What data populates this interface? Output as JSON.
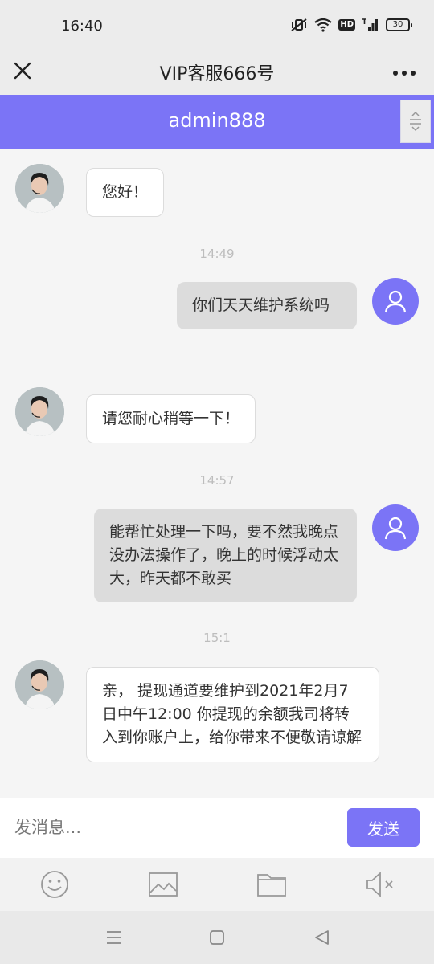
{
  "status_bar": {
    "time": "16:40",
    "battery": "30"
  },
  "title_bar": {
    "title": "VIP客服666号"
  },
  "chat_header": {
    "title": "admin888"
  },
  "messages": [
    {
      "sender": "agent",
      "text": "您好！"
    },
    {
      "timestamp": "14:49"
    },
    {
      "sender": "user",
      "text": "你们天天维护系统吗"
    },
    {
      "sender": "agent",
      "text": "请您耐心稍等一下！"
    },
    {
      "timestamp": "14:57"
    },
    {
      "sender": "user",
      "text": "能帮忙处理一下吗，要不然我晚点没办法操作了，晚上的时候浮动太大，昨天都不敢买"
    },
    {
      "timestamp": "15:1"
    },
    {
      "sender": "agent",
      "text": "亲， 提现通道要维护到2021年2月7日中午12:00 你提现的余额我司将转入到你账户上，给你带来不便敬请谅解"
    }
  ],
  "input": {
    "placeholder": "发消息...",
    "value": ""
  },
  "send_button": {
    "label": "发送"
  },
  "toolbar": {
    "icons": [
      "emoji-icon",
      "image-icon",
      "folder-icon",
      "sound-mute-icon"
    ]
  },
  "nav_bar": {
    "icons": [
      "menu-icon",
      "home-icon",
      "back-icon"
    ]
  },
  "colors": {
    "accent": "#7b74f6",
    "user_bubble": "#dcdcdc",
    "agent_bubble": "#ffffff"
  }
}
